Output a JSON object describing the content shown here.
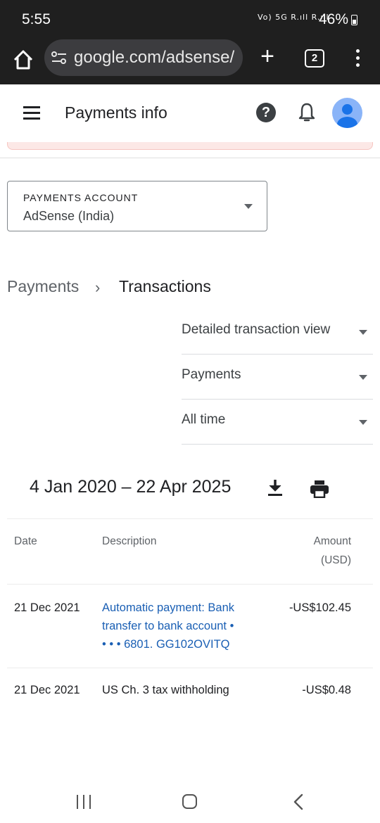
{
  "status_bar": {
    "time": "5:55",
    "network_icons": "Vo) 5G R.ıll R.ıll",
    "battery": "46%"
  },
  "browser": {
    "url": "google.com/adsense/",
    "tab_count": "2",
    "new_tab_symbol": "+"
  },
  "header": {
    "title": "Payments info",
    "help_symbol": "?"
  },
  "account": {
    "label": "PAYMENTS ACCOUNT",
    "value": "AdSense (India)"
  },
  "breadcrumb": {
    "parent": "Payments",
    "separator": "›",
    "current": "Transactions"
  },
  "filters": [
    {
      "label": "Detailed transaction view"
    },
    {
      "label": "Payments"
    },
    {
      "label": "All time"
    }
  ],
  "date_range": "4 Jan 2020 – 22 Apr 2025",
  "table": {
    "headers": {
      "date": "Date",
      "description": "Description",
      "amount": "Amount",
      "amount_unit": "(USD)"
    },
    "rows": [
      {
        "date": "21 Dec 2021",
        "description_lines": [
          "Automatic payment: Bank",
          "transfer to bank account  •",
          "• • • 6801. GG102OVITQ"
        ],
        "amount": "-US$102.45"
      },
      {
        "date": "21 Dec 2021",
        "description_lines": [
          "US Ch. 3 tax withholding"
        ],
        "amount": "-US$0.48"
      }
    ]
  },
  "colors": {
    "link": "#1a5fb4",
    "avatar_bg": "#8ab4f8",
    "avatar_fg": "#1a73e8",
    "alert_bg": "#fce8e6"
  }
}
